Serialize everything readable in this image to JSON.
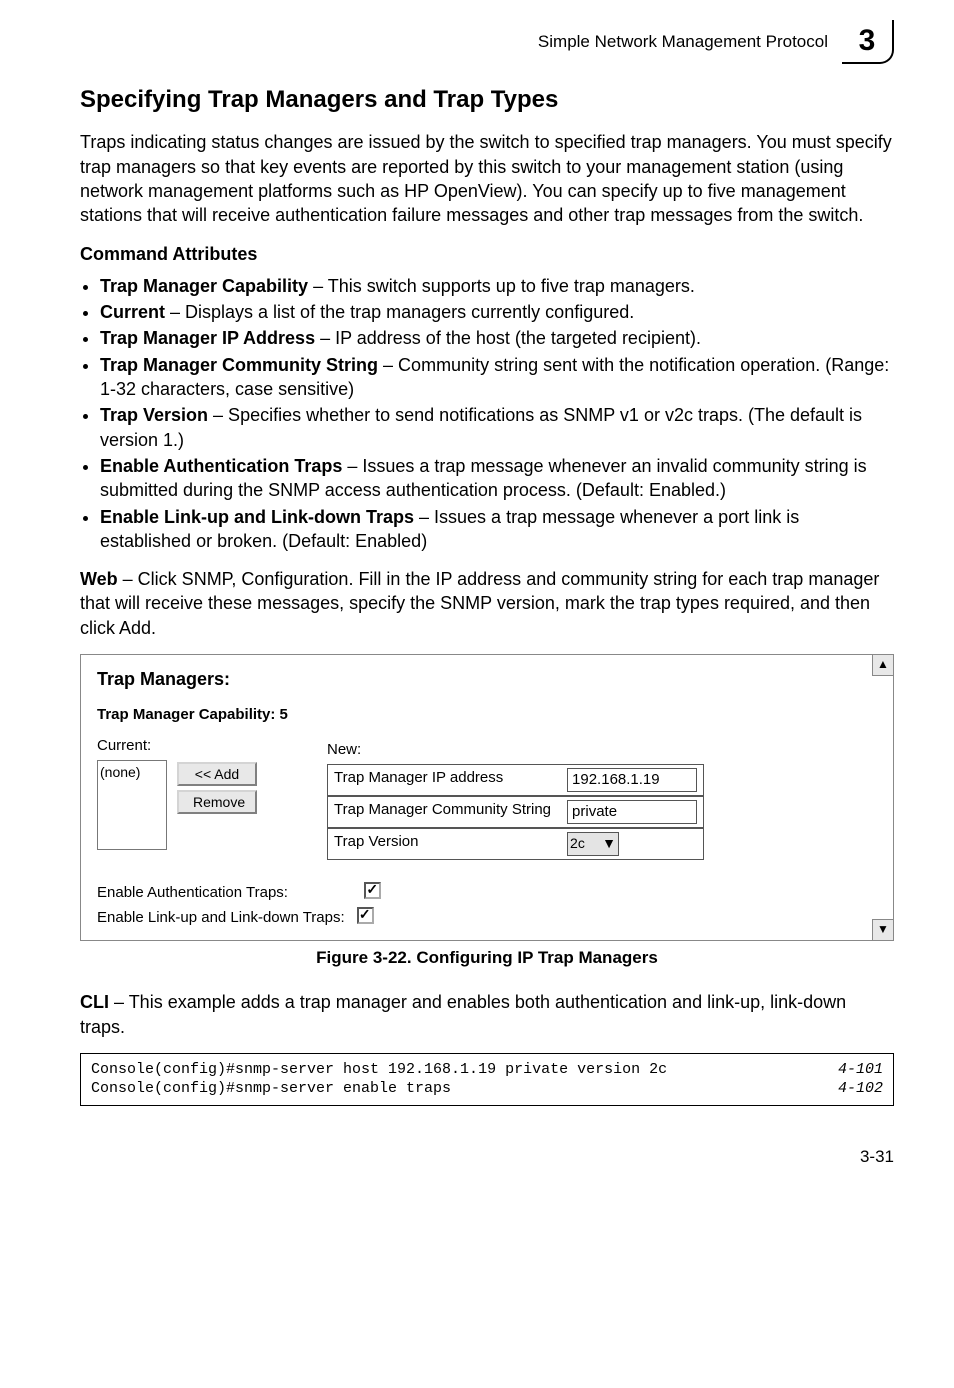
{
  "header": {
    "title": "Simple Network Management Protocol",
    "chapter": "3"
  },
  "section": {
    "title": "Specifying Trap Managers and Trap Types",
    "intro": "Traps indicating status changes are issued by the switch to specified trap managers. You must specify trap managers so that key events are reported by this switch to your management station (using network management platforms such as HP OpenView). You can specify up to five management stations that will receive authentication failure messages and other trap messages from the switch."
  },
  "attrs_title": "Command Attributes",
  "attrs": [
    {
      "term": "Trap Manager Capability",
      "desc": " – This switch supports up to five trap managers."
    },
    {
      "term": "Current",
      "desc": " – Displays a list of the trap managers currently configured."
    },
    {
      "term": "Trap Manager IP Address",
      "desc": " – IP address of the host (the targeted recipient)."
    },
    {
      "term": "Trap Manager Community String",
      "desc": " – Community string sent with the notification operation. (Range: 1-32 characters, case sensitive)"
    },
    {
      "term": "Trap Version",
      "desc": " – Specifies whether to send notifications as SNMP v1 or v2c traps. (The default is version 1.)"
    },
    {
      "term": "Enable Authentication Traps",
      "desc": " – Issues a trap message whenever an invalid community string is submitted during the SNMP access authentication process. (Default: Enabled.)"
    },
    {
      "term": "Enable Link-up and Link-down Traps",
      "desc": " – Issues a trap message whenever a port link is established or broken. (Default: Enabled)"
    }
  ],
  "web_lead": "Web",
  "web_body": " – Click SNMP, Configuration. Fill in the IP address and community string for each trap manager that will receive these messages, specify the SNMP version, mark the trap types required, and then click Add.",
  "screenshot": {
    "title": "Trap Managers:",
    "capability": "Trap Manager Capability: 5",
    "current_label": "Current:",
    "current_value": "(none)",
    "add_btn": "<< Add",
    "remove_btn": "Remove",
    "new_label": "New:",
    "rows": {
      "ip_label": "Trap Manager IP address",
      "ip_value": "192.168.1.19",
      "cs_label": "Trap Manager Community String",
      "cs_value": "private",
      "ver_label": "Trap Version",
      "ver_value": "2c"
    },
    "chk1": "Enable Authentication Traps:",
    "chk2": "Enable Link-up and Link-down Traps:"
  },
  "figure_caption": "Figure 3-22.  Configuring IP Trap Managers",
  "cli_lead": "CLI",
  "cli_body": " – This example adds a trap manager and enables both authentication and link-up, link-down traps.",
  "console": {
    "left": "Console(config)#snmp-server host 192.168.1.19 private version 2c\nConsole(config)#snmp-server enable traps",
    "right": "4-101\n4-102"
  },
  "page_number": "3-31"
}
